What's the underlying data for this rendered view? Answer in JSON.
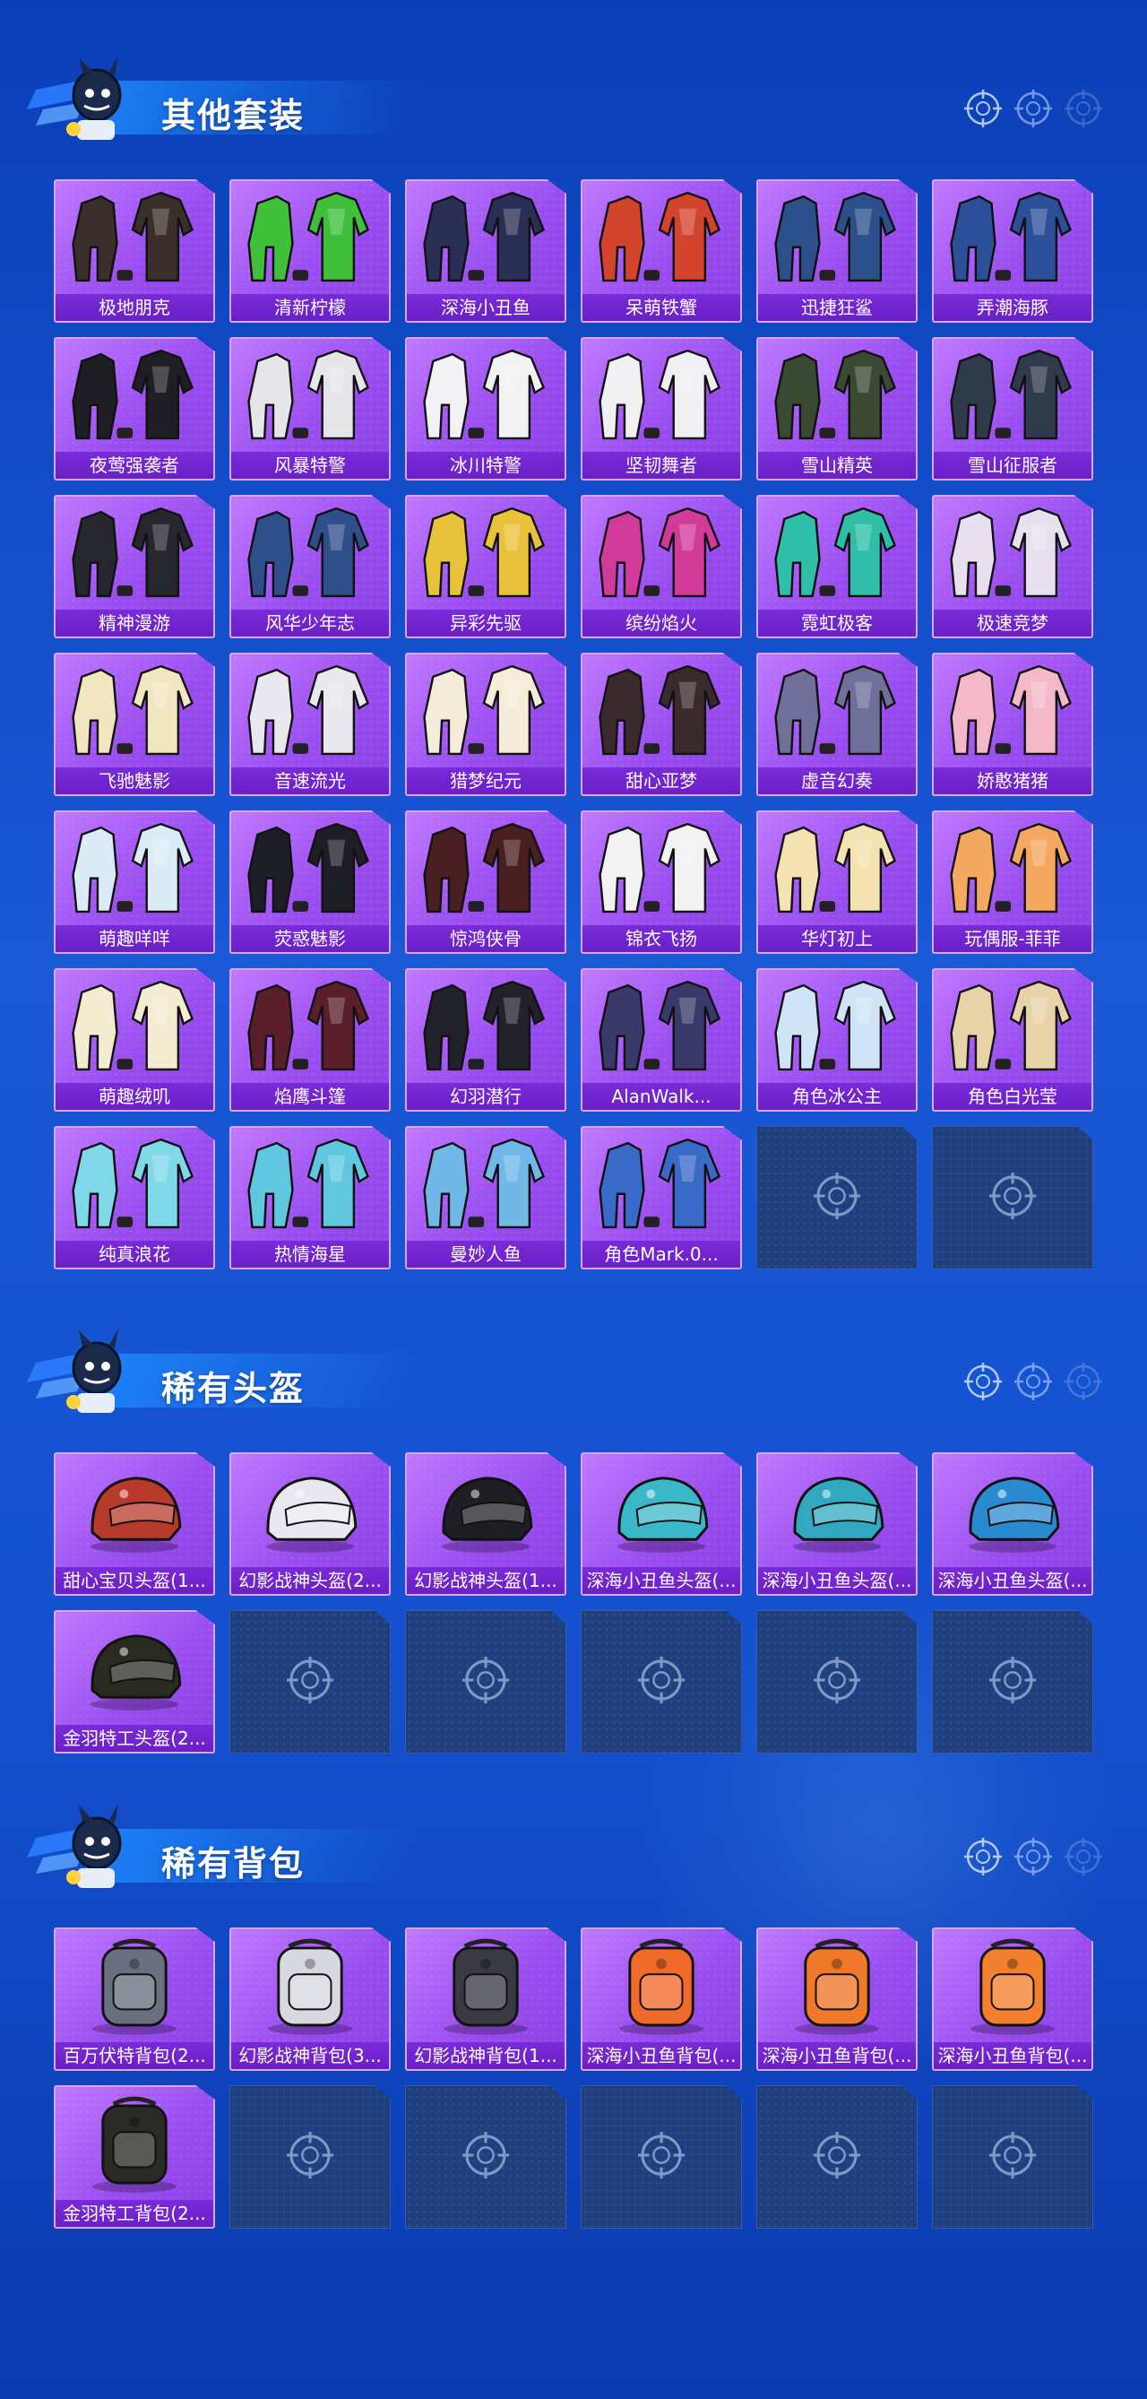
{
  "sections": [
    {
      "title": "其他套装",
      "items": [
        {
          "name": "极地朋克",
          "kind": "outfit",
          "color": "#3a2f2a"
        },
        {
          "name": "清新柠檬",
          "kind": "outfit",
          "color": "#3fbf3a"
        },
        {
          "name": "深海小丑鱼",
          "kind": "outfit",
          "color": "#2a2f55"
        },
        {
          "name": "呆萌铁蟹",
          "kind": "outfit",
          "color": "#d2452c"
        },
        {
          "name": "迅捷狂鲨",
          "kind": "outfit",
          "color": "#2a4f8a"
        },
        {
          "name": "弄潮海豚",
          "kind": "outfit",
          "color": "#2c4f9a"
        },
        {
          "name": "夜莺强袭者",
          "kind": "outfit",
          "color": "#1e1e24"
        },
        {
          "name": "风暴特警",
          "kind": "outfit",
          "color": "#e6e6ea"
        },
        {
          "name": "冰川特警",
          "kind": "outfit",
          "color": "#f2f2f4"
        },
        {
          "name": "坚韧舞者",
          "kind": "outfit",
          "color": "#f0f0f2"
        },
        {
          "name": "雪山精英",
          "kind": "outfit",
          "color": "#3a4a32"
        },
        {
          "name": "雪山征服者",
          "kind": "outfit",
          "color": "#2f3a4a"
        },
        {
          "name": "精神漫游",
          "kind": "outfit",
          "color": "#26262e"
        },
        {
          "name": "风华少年志",
          "kind": "outfit",
          "color": "#2f4f8a"
        },
        {
          "name": "异彩先驱",
          "kind": "outfit",
          "color": "#e8c23a"
        },
        {
          "name": "缤纷焰火",
          "kind": "outfit",
          "color": "#d23a9a"
        },
        {
          "name": "霓虹极客",
          "kind": "outfit",
          "color": "#2fbfa8"
        },
        {
          "name": "极速竞梦",
          "kind": "outfit",
          "color": "#e8e0ef"
        },
        {
          "name": "飞驰魅影",
          "kind": "outfit",
          "color": "#f2e6c0"
        },
        {
          "name": "音速流光",
          "kind": "outfit",
          "color": "#e8e8ee"
        },
        {
          "name": "猎梦纪元",
          "kind": "outfit",
          "color": "#f4ecd8"
        },
        {
          "name": "甜心亚梦",
          "kind": "outfit",
          "color": "#3a2a2e"
        },
        {
          "name": "虚音幻奏",
          "kind": "outfit",
          "color": "#6f6f9a"
        },
        {
          "name": "娇憨猪猪",
          "kind": "outfit",
          "color": "#f4b8c8"
        },
        {
          "name": "萌趣咩咩",
          "kind": "outfit",
          "color": "#dcecf6"
        },
        {
          "name": "荧惑魅影",
          "kind": "outfit",
          "color": "#1e1e26"
        },
        {
          "name": "惊鸿侠骨",
          "kind": "outfit",
          "color": "#4a1f22"
        },
        {
          "name": "锦衣飞扬",
          "kind": "outfit",
          "color": "#f2f2f2"
        },
        {
          "name": "华灯初上",
          "kind": "outfit",
          "color": "#f4e2b0"
        },
        {
          "name": "玩偶服-菲菲",
          "kind": "outfit",
          "color": "#f4a860"
        },
        {
          "name": "萌趣绒叽",
          "kind": "outfit",
          "color": "#f4ecd0"
        },
        {
          "name": "焰鹰斗篷",
          "kind": "outfit",
          "color": "#5a1f2a"
        },
        {
          "name": "幻羽潜行",
          "kind": "outfit",
          "color": "#22222a"
        },
        {
          "name": "AlanWalk...",
          "kind": "outfit",
          "color": "#3a3a6a"
        },
        {
          "name": "角色冰公主",
          "kind": "outfit",
          "color": "#cfe4f6"
        },
        {
          "name": "角色白光莹",
          "kind": "outfit",
          "color": "#e8d2a8"
        },
        {
          "name": "纯真浪花",
          "kind": "outfit",
          "color": "#7fd8e8"
        },
        {
          "name": "热情海星",
          "kind": "outfit",
          "color": "#5fc8e0"
        },
        {
          "name": "曼妙人鱼",
          "kind": "outfit",
          "color": "#6fb8e8"
        },
        {
          "name": "角色Mark.0...",
          "kind": "outfit",
          "color": "#3a6ac8"
        },
        null,
        null
      ]
    },
    {
      "title": "稀有头盔",
      "items": [
        {
          "name": "甜心宝贝头盔(1...",
          "kind": "helmet",
          "color": "#b83a2a"
        },
        {
          "name": "幻影战神头盔(2...",
          "kind": "helmet",
          "color": "#e8e8f0"
        },
        {
          "name": "幻影战神头盔(1...",
          "kind": "helmet",
          "color": "#1e1e24"
        },
        {
          "name": "深海小丑鱼头盔(...",
          "kind": "helmet",
          "color": "#3ab8c8"
        },
        {
          "name": "深海小丑鱼头盔(...",
          "kind": "helmet",
          "color": "#2fa8c0"
        },
        {
          "name": "深海小丑鱼头盔(...",
          "kind": "helmet",
          "color": "#2a8ad0"
        },
        {
          "name": "金羽特工头盔(2...",
          "kind": "helmet",
          "color": "#2a2a22"
        },
        null,
        null,
        null,
        null,
        null
      ]
    },
    {
      "title": "稀有背包",
      "items": [
        {
          "name": "百万伏特背包(2...",
          "kind": "backpack",
          "color": "#6a7080"
        },
        {
          "name": "幻影战神背包(3...",
          "kind": "backpack",
          "color": "#d8d8e0"
        },
        {
          "name": "幻影战神背包(1...",
          "kind": "backpack",
          "color": "#3a3a44"
        },
        {
          "name": "深海小丑鱼背包(...",
          "kind": "backpack",
          "color": "#f06a2a"
        },
        {
          "name": "深海小丑鱼背包(...",
          "kind": "backpack",
          "color": "#f0782a"
        },
        {
          "name": "深海小丑鱼背包(...",
          "kind": "backpack",
          "color": "#f2802e"
        },
        {
          "name": "金羽特工背包(2...",
          "kind": "backpack",
          "color": "#2a2a26"
        },
        null,
        null,
        null,
        null,
        null
      ]
    }
  ]
}
